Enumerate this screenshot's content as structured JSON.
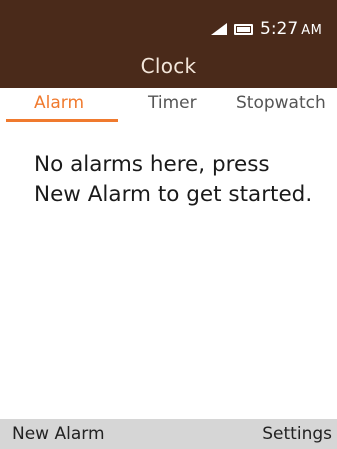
{
  "status_bar": {
    "time": "5:27",
    "ampm": "AM",
    "icons": [
      "signal-icon",
      "battery-icon"
    ]
  },
  "app": {
    "title": "Clock"
  },
  "tabs": [
    {
      "label": "Alarm",
      "selected": true
    },
    {
      "label": "Timer",
      "selected": false
    },
    {
      "label": "Stopwatch",
      "selected": false
    }
  ],
  "content": {
    "empty_message": "No alarms here, press New Alarm to get started."
  },
  "softkeys": {
    "left": "New Alarm",
    "right": "Settings"
  },
  "colors": {
    "header_bg": "#4a2a1a",
    "accent": "#f07a2e",
    "softkey_bg": "#d6d6d6"
  }
}
